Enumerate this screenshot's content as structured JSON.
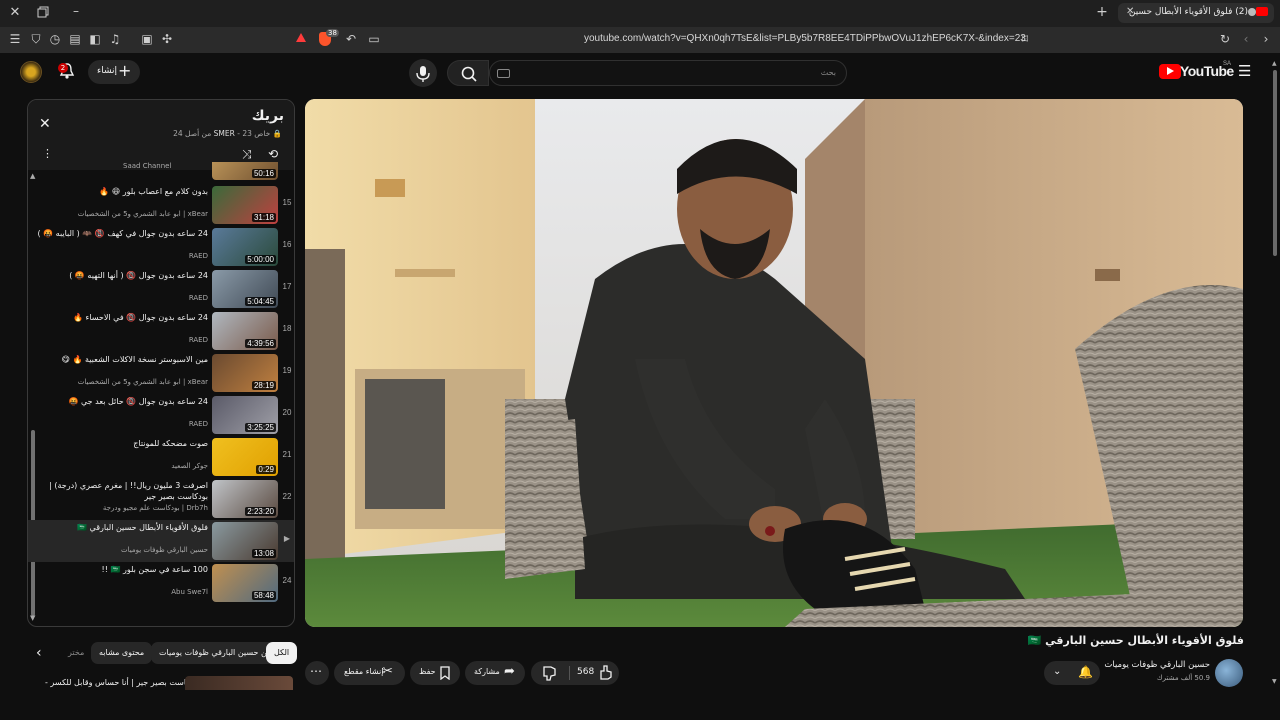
{
  "browser": {
    "tab_title": "(2) فلوق الأقوياء الأبطال حسين",
    "tab_badge": "38",
    "url": "youtube.com/watch?v=QHXn0qh7TsE&list=PLBy5b7R8EE4TDiPPbwOVuJ1zhEP6cK7X-&index=23"
  },
  "header": {
    "logo_text": "YouTube",
    "region": "SA",
    "search_placeholder": "بحث",
    "create_label": "إنشاء",
    "notification_count": "2"
  },
  "playlist": {
    "title": "بريك",
    "meta_privacy": "خاص",
    "meta_owner": "SMER",
    "meta_position": "- 23 من أصل 24",
    "partial_top_label": "Saad Channel",
    "partial_top_duration": "50:16",
    "items": [
      {
        "num": "15",
        "title": "بدون كلام مع اعصاب بلور 😆 🔥",
        "channel": "xBear | ابو عابد الشمري و5 من الشخصيات",
        "duration": "31:18"
      },
      {
        "num": "16",
        "title": "24 ساعه بدون جوال في كهف 📵 🦇 ( البايبه 🤬 )",
        "channel": "RAED",
        "duration": "5:00:00"
      },
      {
        "num": "17",
        "title": "24 ساعه بدون جوال 📵 ( أنها التهيه 🤬 )",
        "channel": "RAED",
        "duration": "5:04:45"
      },
      {
        "num": "18",
        "title": "24 ساعه بدون جوال 📵 في الاحساء 🔥",
        "channel": "RAED",
        "duration": "4:39:56"
      },
      {
        "num": "19",
        "title": "مين الاسبوستر نسخة الاكلات الشعبية 🔥 😋",
        "channel": "xBear | ابو عابد الشمري و5 من الشخصيات",
        "duration": "28:19"
      },
      {
        "num": "20",
        "title": "24 ساعه بدون جوال 📵 حائل بعد جي 🤬",
        "channel": "RAED",
        "duration": "3:25:25"
      },
      {
        "num": "21",
        "title": "صوت مضحكه للمونتاج",
        "channel": "جوكر الصعيد",
        "duration": "0:29"
      },
      {
        "num": "22",
        "title": "اصرفت 3 مليون ريال!! | مغرم عصري (درجة) | بودكاست بصير جير",
        "channel": "Drb7h | بودكاست علم مجيو ودرجة",
        "duration": "2:23:20"
      },
      {
        "num": "▶",
        "title": "فلوق الأقوياء الأبطال حسين البارقي 🇸🇦",
        "channel": "حسين البارقي ظوفات يوميات",
        "duration": "13:08"
      },
      {
        "num": "24",
        "title": "100 ساعة في سجن بلور 🇸🇦 !!",
        "channel": "Abu Swe7l",
        "duration": "58:48"
      }
    ]
  },
  "chips": {
    "all": "الكل",
    "from_channel": "من حسين البارقي ظوفات يوميات",
    "similar": "محتوى مشابه",
    "more": "مختر"
  },
  "next_video_label": "بودكاست بصير جير | أنا حساس وقابل للكسر -",
  "video": {
    "title": "فلوق الأقوياء الأبطال حسين البارقي 🇸🇦",
    "channel": "حسين البارقي ظوفات يوميات",
    "subscribers": "50.9 ألف مشترك",
    "likes": "568",
    "share_label": "مشاركة",
    "save_label": "حفظ",
    "clip_label": "إنشاء مقطع"
  },
  "colors": {
    "accent_red": "#ff0000",
    "bg": "#0f0f0f",
    "surface": "#272727"
  }
}
